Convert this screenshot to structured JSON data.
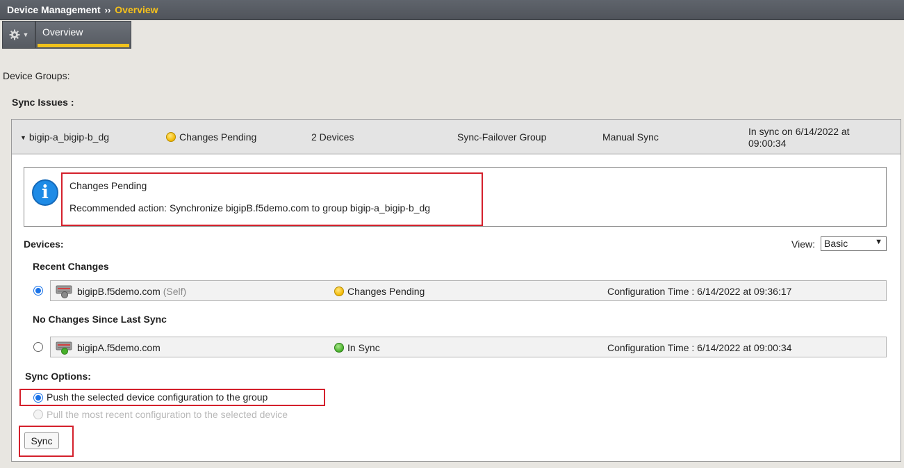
{
  "breadcrumb": {
    "root": "Device Management",
    "separator": "››",
    "current": "Overview"
  },
  "tabs": [
    {
      "label": "Overview",
      "active": true
    }
  ],
  "toolbar": {
    "gear_icon": "gear-icon",
    "caret_icon": "chevron-down-icon"
  },
  "labels": {
    "device_groups": "Device Groups:",
    "sync_issues": "Sync Issues :"
  },
  "group": {
    "name": "bigip-a_bigip-b_dg",
    "status": "Changes Pending",
    "status_color": "#f2b800",
    "devices": "2 Devices",
    "type": "Sync-Failover Group",
    "sync_mode": "Manual Sync",
    "sync_state_line1": "In sync on 6/14/2022 at",
    "sync_state_line2": "09:00:34"
  },
  "info": {
    "icon": "info-icon",
    "title": "Changes Pending",
    "message": "Recommended action: Synchronize bigipB.f5demo.com to group bigip-a_bigip-b_dg"
  },
  "devices_section": {
    "label": "Devices:",
    "view_label": "View:",
    "view_value": "Basic",
    "recent_label": "Recent Changes",
    "no_changes_label": "No Changes Since Last Sync",
    "rows": [
      {
        "name": "bigipB.f5demo.com",
        "self": "(Self)",
        "status": "Changes Pending",
        "status_color": "#f2b800",
        "time": "Configuration Time : 6/14/2022 at 09:36:17",
        "selected": true
      },
      {
        "name": "bigipA.f5demo.com",
        "self": "",
        "status": "In Sync",
        "status_color": "#47b02a",
        "time": "Configuration Time : 6/14/2022 at 09:00:34",
        "selected": false
      }
    ]
  },
  "sync_options": {
    "label": "Sync Options:",
    "push": "Push the selected device configuration to the group",
    "pull": "Pull the most recent configuration to the selected device",
    "button": "Sync"
  },
  "colors": {
    "highlight": "#d4202c",
    "accent": "#f0c21c",
    "topbar": "#5f646c"
  }
}
